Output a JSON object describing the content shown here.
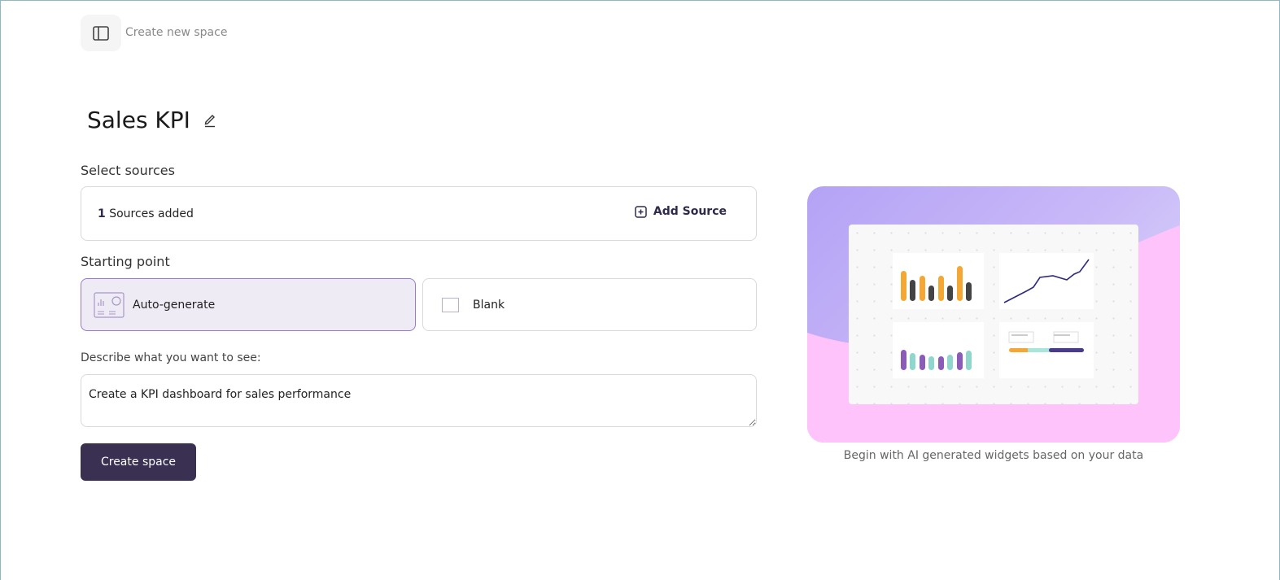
{
  "header": {
    "breadcrumb": "Create new space",
    "sidebar_icon": "sidebar-toggle-icon"
  },
  "page": {
    "title": "Sales KPI",
    "edit_icon": "pencil-icon"
  },
  "sources": {
    "label": "Select sources",
    "count": "1",
    "count_suffix": " Sources added",
    "add_label": "Add Source",
    "add_icon": "plus-square-icon"
  },
  "starting_point": {
    "label": "Starting point",
    "options": [
      {
        "label": "Auto-generate",
        "selected": true,
        "icon": "dashboard-icon"
      },
      {
        "label": "Blank",
        "selected": false,
        "icon": "blank-square-icon"
      }
    ]
  },
  "description": {
    "label": "Describe what you want to see:",
    "value": "Create a KPI dashboard for sales performance"
  },
  "actions": {
    "create_label": "Create space"
  },
  "preview": {
    "caption": "Begin with AI generated widgets based on your data"
  },
  "colors": {
    "primary": "#3a3152",
    "accent": "#9a7ac8",
    "orange": "#f5a733",
    "teal": "#8fd6cc",
    "purple": "#8a5cb8"
  }
}
